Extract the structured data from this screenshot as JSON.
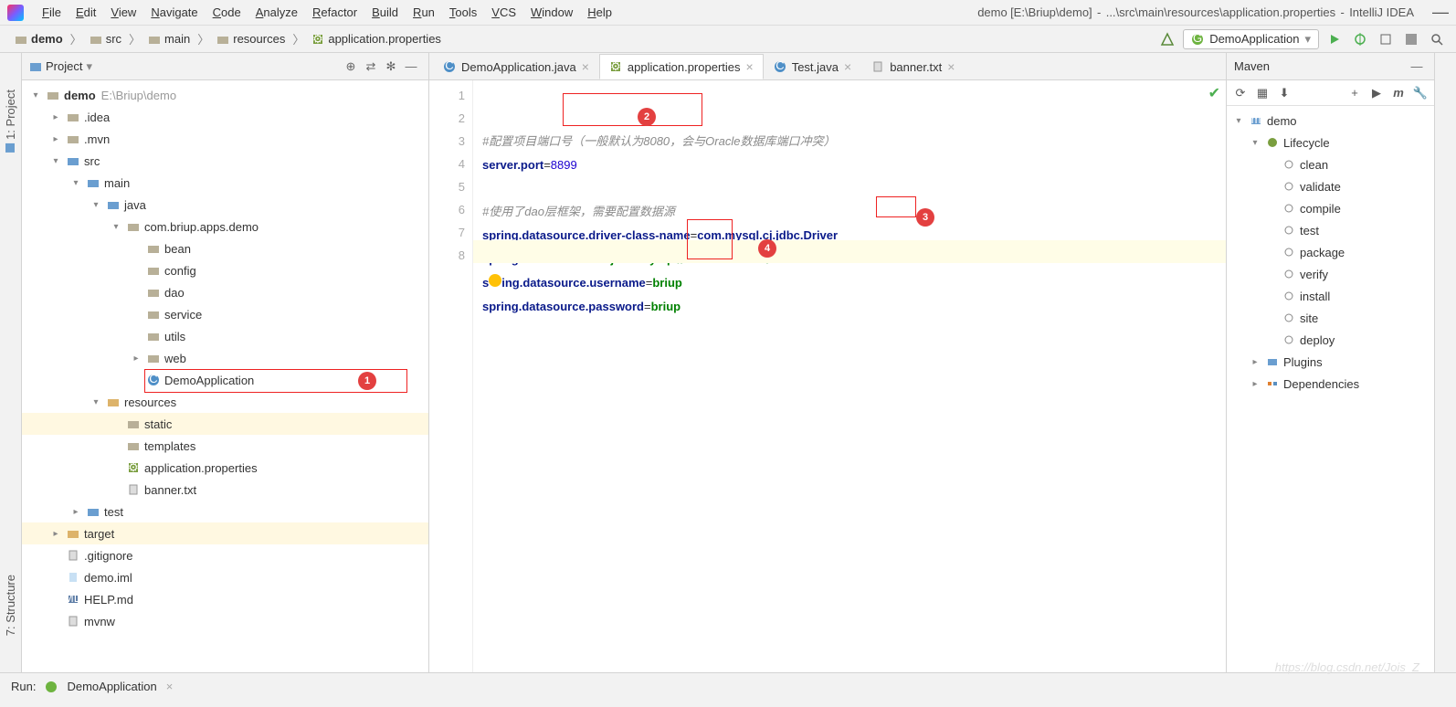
{
  "menu": {
    "items": [
      "File",
      "Edit",
      "View",
      "Navigate",
      "Code",
      "Analyze",
      "Refactor",
      "Build",
      "Run",
      "Tools",
      "VCS",
      "Window",
      "Help"
    ]
  },
  "title": {
    "project": "demo",
    "projectPath": "[E:\\Briup\\demo]",
    "filePath": "...\\src\\main\\resources\\application.properties",
    "ide": "IntelliJ IDEA"
  },
  "breadcrumbs": [
    {
      "icon": "folder",
      "label": "demo",
      "bold": true
    },
    {
      "icon": "folder",
      "label": "src"
    },
    {
      "icon": "folder",
      "label": "main"
    },
    {
      "icon": "folder",
      "label": "resources"
    },
    {
      "icon": "props",
      "label": "application.properties"
    }
  ],
  "runConfig": {
    "label": "DemoApplication"
  },
  "projectTool": {
    "title": "Project"
  },
  "tree": [
    {
      "d": 0,
      "arr": "v",
      "ic": "folder",
      "lbl": "demo",
      "path": "E:\\Briup\\demo",
      "bold": true
    },
    {
      "d": 1,
      "arr": ">",
      "ic": "folder",
      "lbl": ".idea"
    },
    {
      "d": 1,
      "arr": ">",
      "ic": "folder",
      "lbl": ".mvn"
    },
    {
      "d": 1,
      "arr": "v",
      "ic": "folder-b",
      "lbl": "src"
    },
    {
      "d": 2,
      "arr": "v",
      "ic": "folder-b",
      "lbl": "main"
    },
    {
      "d": 3,
      "arr": "v",
      "ic": "folder-b",
      "lbl": "java"
    },
    {
      "d": 4,
      "arr": "v",
      "ic": "folder",
      "lbl": "com.briup.apps.demo"
    },
    {
      "d": 5,
      "arr": "",
      "ic": "folder",
      "lbl": "bean"
    },
    {
      "d": 5,
      "arr": "",
      "ic": "folder",
      "lbl": "config"
    },
    {
      "d": 5,
      "arr": "",
      "ic": "folder",
      "lbl": "dao"
    },
    {
      "d": 5,
      "arr": "",
      "ic": "folder",
      "lbl": "service"
    },
    {
      "d": 5,
      "arr": "",
      "ic": "folder",
      "lbl": "utils"
    },
    {
      "d": 5,
      "arr": ">",
      "ic": "folder",
      "lbl": "web"
    },
    {
      "d": 5,
      "arr": "",
      "ic": "class",
      "lbl": "DemoApplication",
      "hl": true,
      "badge": "1"
    },
    {
      "d": 3,
      "arr": "v",
      "ic": "folder-o",
      "lbl": "resources"
    },
    {
      "d": 4,
      "arr": "",
      "ic": "folder",
      "lbl": "static",
      "sel": true
    },
    {
      "d": 4,
      "arr": "",
      "ic": "folder",
      "lbl": "templates"
    },
    {
      "d": 4,
      "arr": "",
      "ic": "props",
      "lbl": "application.properties"
    },
    {
      "d": 4,
      "arr": "",
      "ic": "txt",
      "lbl": "banner.txt"
    },
    {
      "d": 2,
      "arr": ">",
      "ic": "folder-b",
      "lbl": "test"
    },
    {
      "d": 1,
      "arr": ">",
      "ic": "folder-o",
      "lbl": "target",
      "sel2": true
    },
    {
      "d": 1,
      "arr": "",
      "ic": "txt",
      "lbl": ".gitignore"
    },
    {
      "d": 1,
      "arr": "",
      "ic": "iml",
      "lbl": "demo.iml"
    },
    {
      "d": 1,
      "arr": "",
      "ic": "md",
      "lbl": "HELP.md"
    },
    {
      "d": 1,
      "arr": "",
      "ic": "txt",
      "lbl": "mvnw"
    }
  ],
  "tabs": [
    {
      "icon": "class",
      "label": "DemoApplication.java"
    },
    {
      "icon": "props",
      "label": "application.properties",
      "active": true
    },
    {
      "icon": "class",
      "label": "Test.java"
    },
    {
      "icon": "txt",
      "label": "banner.txt"
    }
  ],
  "editor": {
    "lines": [
      "1",
      "2",
      "3",
      "4",
      "5",
      "6",
      "7",
      "8"
    ],
    "comment1": "#配置项目端口号（一般默认为8080，会与Oracle数据库端口冲突）",
    "l2k": "server.port",
    "l2v": "8899",
    "comment2": "#使用了dao层框架，需要配置数据源",
    "l5k": "spring.datasource.driver-class-name",
    "l5v": "com.mysql.cj.jdbc.Driver",
    "l6k": "spring.datasource.url",
    "l6v1": "jdbc:mysql://localhost:3306/",
    "l6v2": "demo",
    "l6v3": "?serverTimezone=UTC",
    "l7k1": "s",
    "l7k2": "ing.datasource.username",
    "l7v": "briup",
    "l8k": "spring.datasource.password",
    "l8v": "briup",
    "badges": {
      "b2": "2",
      "b3": "3",
      "b4": "4"
    }
  },
  "maven": {
    "title": "Maven",
    "root": "demo",
    "lifecycle": "Lifecycle",
    "goals": [
      "clean",
      "validate",
      "compile",
      "test",
      "package",
      "verify",
      "install",
      "site",
      "deploy"
    ],
    "plugins": "Plugins",
    "deps": "Dependencies"
  },
  "sideTabs": {
    "project": "1: Project",
    "structure": "7: Structure"
  },
  "bottom": {
    "run": "Run:",
    "config": "DemoApplication"
  },
  "watermark": "https://blog.csdn.net/Jois_Z"
}
